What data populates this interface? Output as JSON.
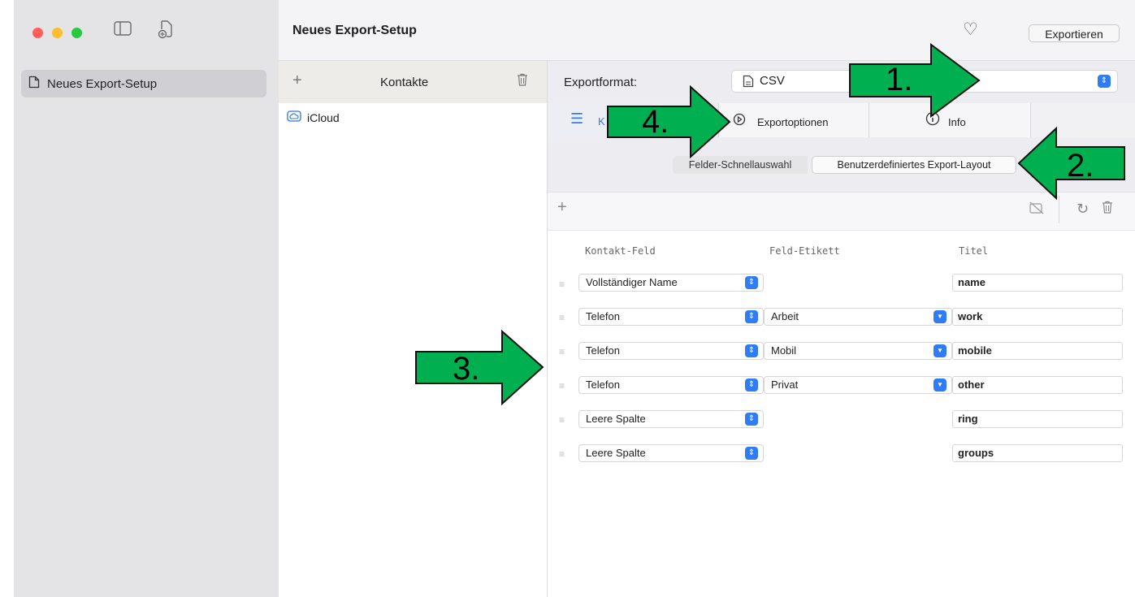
{
  "window": {
    "title": "Neues Export-Setup",
    "export_button": "Exportieren",
    "traffic_light_colors": [
      "#ff5f57",
      "#febc2e",
      "#28c840"
    ]
  },
  "sidebar": {
    "items": [
      {
        "label": "Neues Export-Setup",
        "icon": "document-icon"
      }
    ]
  },
  "middle": {
    "header": "Kontakte",
    "sources": [
      {
        "label": "iCloud",
        "icon": "cloud-icon"
      }
    ]
  },
  "format": {
    "label": "Exportformat:",
    "value": "CSV"
  },
  "tabs": [
    {
      "label": "K",
      "icon": "list-icon",
      "active": true
    },
    {
      "label": "Exportoptionen",
      "icon": "play-circle-icon"
    },
    {
      "label": "Info",
      "icon": "info-icon"
    }
  ],
  "segments": [
    "Felder-Schnellauswahl",
    "Benutzerdefiniertes Export-Layout"
  ],
  "columns": [
    "Kontakt-Feld",
    "Feld-Etikett",
    "Titel"
  ],
  "rows": [
    {
      "field": "Vollständiger Name",
      "label": "",
      "title": "name"
    },
    {
      "field": "Telefon",
      "label": "Arbeit",
      "title": "work"
    },
    {
      "field": "Telefon",
      "label": "Mobil",
      "title": "mobile"
    },
    {
      "field": "Telefon",
      "label": "Privat",
      "title": "other"
    },
    {
      "field": "Leere Spalte",
      "label": "",
      "title": "ring"
    },
    {
      "field": "Leere Spalte",
      "label": "",
      "title": "groups"
    }
  ],
  "annotations": {
    "arrow_color": "#00b050",
    "labels": [
      "1.",
      "2.",
      "3.",
      "4."
    ]
  }
}
